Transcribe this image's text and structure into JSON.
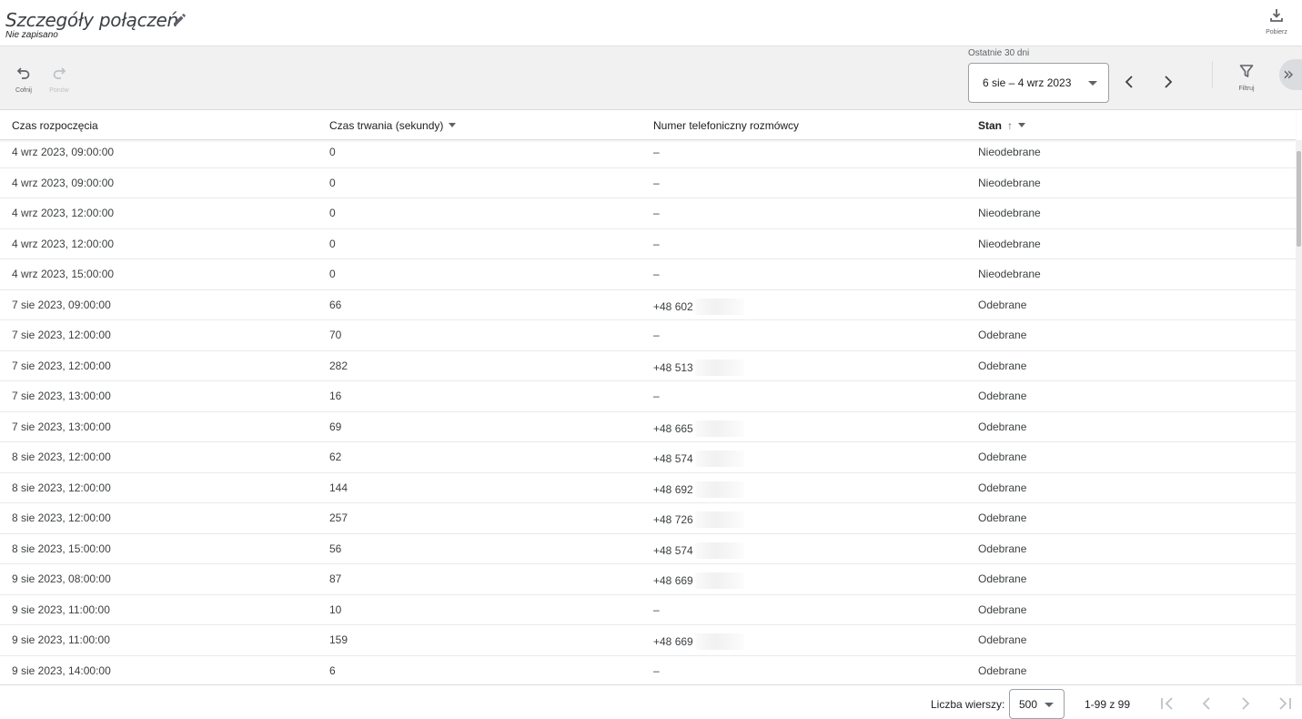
{
  "header": {
    "title": "Szczegóły połączeń",
    "subtitle": "Nie zapisano",
    "download_label": "Pobierz"
  },
  "toolbar": {
    "undo_label": "Cofnij",
    "redo_label": "Ponów",
    "range_caption": "Ostatnie 30 dni",
    "range_value": "6 sie – 4 wrz 2023",
    "filter_label": "Filtruj",
    "collapse_glyph": "»"
  },
  "table": {
    "columns": {
      "start_time": "Czas rozpoczęcia",
      "duration": "Czas trwania (sekundy)",
      "caller": "Numer telefoniczny rozmówcy",
      "status": "Stan",
      "status_sort_arrow": "↑"
    },
    "rows": [
      {
        "start": "4 wrz 2023, 09:00:00",
        "duration": "0",
        "caller": "–",
        "status": "Nieodebrane"
      },
      {
        "start": "4 wrz 2023, 09:00:00",
        "duration": "0",
        "caller": "–",
        "status": "Nieodebrane"
      },
      {
        "start": "4 wrz 2023, 12:00:00",
        "duration": "0",
        "caller": "–",
        "status": "Nieodebrane"
      },
      {
        "start": "4 wrz 2023, 12:00:00",
        "duration": "0",
        "caller": "–",
        "status": "Nieodebrane"
      },
      {
        "start": "4 wrz 2023, 15:00:00",
        "duration": "0",
        "caller": "–",
        "status": "Nieodebrane"
      },
      {
        "start": "7 sie 2023, 09:00:00",
        "duration": "66",
        "caller": "+48 602",
        "status": "Odebrane"
      },
      {
        "start": "7 sie 2023, 12:00:00",
        "duration": "70",
        "caller": "–",
        "status": "Odebrane"
      },
      {
        "start": "7 sie 2023, 12:00:00",
        "duration": "282",
        "caller": "+48 513",
        "status": "Odebrane"
      },
      {
        "start": "7 sie 2023, 13:00:00",
        "duration": "16",
        "caller": "–",
        "status": "Odebrane"
      },
      {
        "start": "7 sie 2023, 13:00:00",
        "duration": "69",
        "caller": "+48 665",
        "status": "Odebrane"
      },
      {
        "start": "8 sie 2023, 12:00:00",
        "duration": "62",
        "caller": "+48 574",
        "status": "Odebrane"
      },
      {
        "start": "8 sie 2023, 12:00:00",
        "duration": "144",
        "caller": "+48 692",
        "status": "Odebrane"
      },
      {
        "start": "8 sie 2023, 12:00:00",
        "duration": "257",
        "caller": "+48 726",
        "status": "Odebrane"
      },
      {
        "start": "8 sie 2023, 15:00:00",
        "duration": "56",
        "caller": "+48 574",
        "status": "Odebrane"
      },
      {
        "start": "9 sie 2023, 08:00:00",
        "duration": "87",
        "caller": "+48 669",
        "status": "Odebrane"
      },
      {
        "start": "9 sie 2023, 11:00:00",
        "duration": "10",
        "caller": "–",
        "status": "Odebrane"
      },
      {
        "start": "9 sie 2023, 11:00:00",
        "duration": "159",
        "caller": "+48 669",
        "status": "Odebrane"
      },
      {
        "start": "9 sie 2023, 14:00:00",
        "duration": "6",
        "caller": "–",
        "status": "Odebrane"
      }
    ]
  },
  "footer": {
    "rows_label": "Liczba wierszy:",
    "rows_value": "500",
    "range_info": "1-99 z 99"
  }
}
